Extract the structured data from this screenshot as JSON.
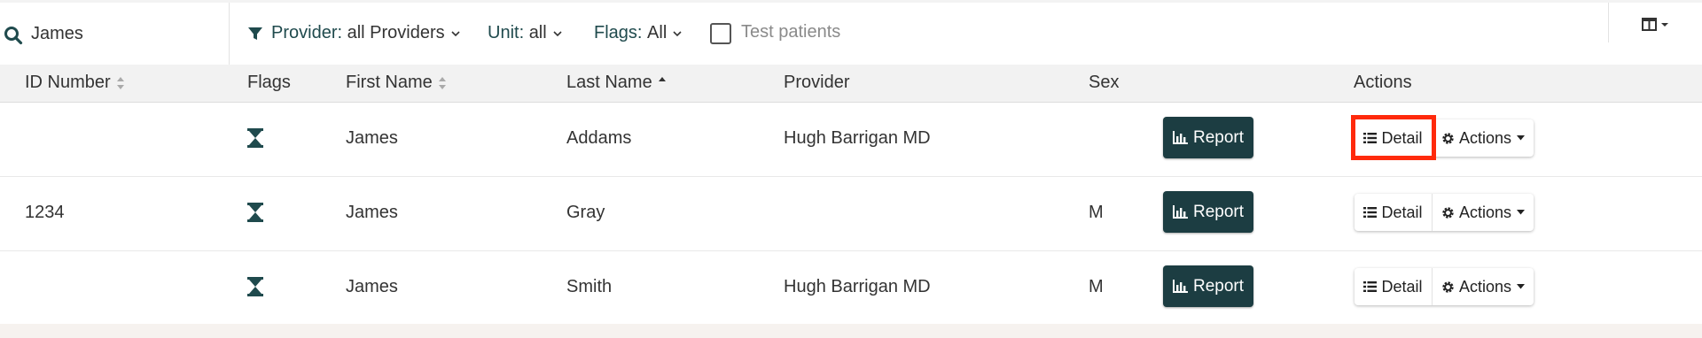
{
  "search": {
    "value": "James"
  },
  "filters": {
    "provider_label": "Provider:",
    "provider_value": "all Providers",
    "unit_label": "Unit:",
    "unit_value": "all",
    "flags_label": "Flags:",
    "flags_value": "All",
    "test_patients_label": "Test patients",
    "test_patients_checked": false
  },
  "columns": {
    "id": "ID Number",
    "flags": "Flags",
    "first_name": "First Name",
    "last_name": "Last Name",
    "provider": "Provider",
    "sex": "Sex",
    "actions": "Actions"
  },
  "sorting": {
    "column": "Last Name",
    "direction": "ascending"
  },
  "rows": [
    {
      "id": "",
      "first_name": "James",
      "last_name": "Addams",
      "provider": "Hugh Barrigan MD",
      "sex": "",
      "report_label": "Report",
      "detail_label": "Detail",
      "actions_label": "Actions"
    },
    {
      "id": "1234",
      "first_name": "James",
      "last_name": "Gray",
      "provider": "",
      "sex": "M",
      "report_label": "Report",
      "detail_label": "Detail",
      "actions_label": "Actions"
    },
    {
      "id": "",
      "first_name": "James",
      "last_name": "Smith",
      "provider": "Hugh Barrigan MD",
      "sex": "M",
      "report_label": "Report",
      "detail_label": "Detail",
      "actions_label": "Actions"
    }
  ],
  "icons": {
    "search": "search-icon",
    "filter": "filter-icon",
    "flag": "hourglass-icon",
    "report": "bar-chart-icon",
    "detail": "list-icon",
    "actions": "gear-icon",
    "columns": "columns-icon"
  },
  "colors": {
    "accent": "#1f4a4d",
    "report_button": "#1c3d42",
    "highlight": "#ff2a0c"
  }
}
